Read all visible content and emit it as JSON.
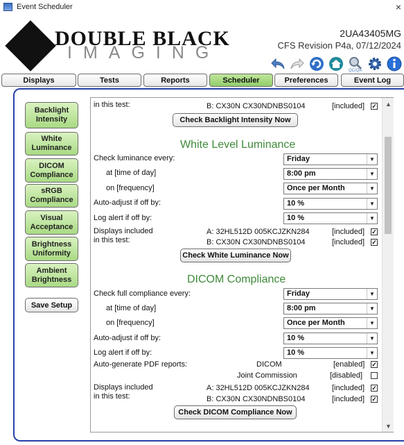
{
  "window": {
    "title": "Event Scheduler",
    "close": "×"
  },
  "header": {
    "logo_line1": "DOUBLE BLACK",
    "logo_line2": "IMAGING",
    "serial": "2UA43405MG",
    "revision": "CFS Revision P4a, 07/12/2024",
    "toolbar_icons": [
      "undo-arrow-icon",
      "redo-arrow-icon",
      "refresh-icon",
      "home-icon",
      "qc-magnifier-icon",
      "gear-icon",
      "info-icon"
    ],
    "qc_caption": "QC/QA"
  },
  "tabs": [
    {
      "label": "Displays",
      "active": false
    },
    {
      "label": "Tests",
      "active": false
    },
    {
      "label": "Reports",
      "active": false
    },
    {
      "label": "Scheduler",
      "active": true
    },
    {
      "label": "Preferences",
      "active": false
    },
    {
      "label": "Event Log",
      "active": false
    }
  ],
  "sidebar": {
    "items": [
      {
        "label": "Backlight Intensity"
      },
      {
        "label": "White Luminance"
      },
      {
        "label": "DICOM Compliance"
      },
      {
        "label": "sRGB Compliance"
      },
      {
        "label": "Visual Acceptance"
      },
      {
        "label": "Brightness Uniformity"
      },
      {
        "label": "Ambient Brightness"
      }
    ],
    "save_label": "Save Setup"
  },
  "backlight_partial": {
    "label": "in this test:",
    "display": "B:  CX30N   CX30NDNBS0104",
    "status": "[included]",
    "button": "Check Backlight Intensity Now"
  },
  "white": {
    "heading": "White Level Luminance",
    "check_every_label": "Check luminance every:",
    "check_every_value": "Friday",
    "time_label": "at [time of day]",
    "time_value": "8:00 pm",
    "freq_label": "on [frequency]",
    "freq_value": "Once per Month",
    "adjust_label": "Auto-adjust if off by:",
    "adjust_value": "10 %",
    "alert_label": "Log alert if off by:",
    "alert_value": "10 %",
    "displays_label1": "Displays included",
    "displays_label2": "in this test:",
    "display_a": "A:  32HL512D   005KCJZKN284",
    "display_b": "B:  CX30N   CX30NDNBS0104",
    "status_a": "[included]",
    "status_b": "[included]",
    "button": "Check White Luminance Now"
  },
  "dicom": {
    "heading": "DICOM Compliance",
    "check_every_label": "Check full compliance every:",
    "check_every_value": "Friday",
    "time_label": "at [time of day]",
    "time_value": "8:00 pm",
    "freq_label": "on [frequency]",
    "freq_value": "Once per Month",
    "adjust_label": "Auto-adjust if off by:",
    "adjust_value": "10 %",
    "alert_label": "Log alert if off by:",
    "alert_value": "10 %",
    "pdf_label": "Auto-generate PDF reports:",
    "pdf_dicom": "DICOM",
    "pdf_dicom_status": "[enabled]",
    "pdf_joint": "Joint Commission",
    "pdf_joint_status": "[disabled]",
    "displays_label1": "Displays included",
    "displays_label2": "in this test:",
    "display_a": "A:  32HL512D   005KCJZKN284",
    "display_b": "B:  CX30N   CX30NDNBS0104",
    "status_a": "[included]",
    "status_b": "[included]",
    "button": "Check DICOM Compliance Now"
  },
  "checks": {
    "checked_glyph": "✓",
    "dropdown_glyph": "▼"
  },
  "scrollbar": {
    "up": "▲",
    "down": "▼"
  }
}
